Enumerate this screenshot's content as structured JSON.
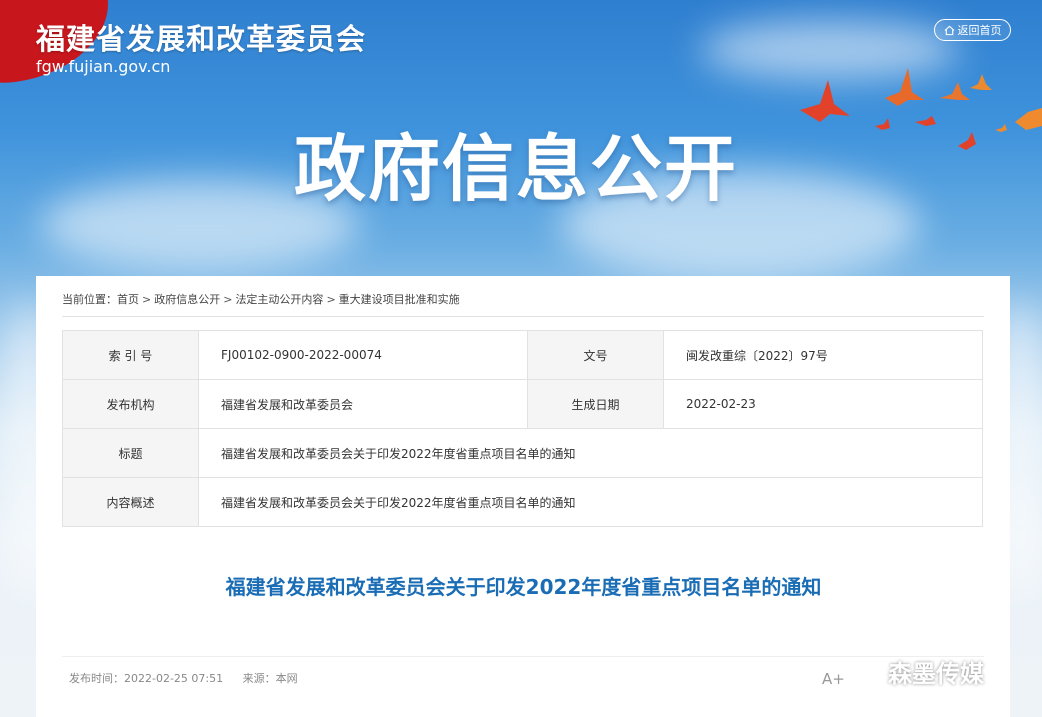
{
  "header": {
    "site_title": "福建省发展和改革委员会",
    "site_domain": "fgw.fujian.gov.cn",
    "back_home": "返回首页",
    "banner_heading": "政府信息公开"
  },
  "breadcrumb": {
    "prefix": "当前位置：",
    "items": [
      "首页",
      "政府信息公开",
      "法定主动公开内容",
      "重大建设项目批准和实施"
    ],
    "separator": ">"
  },
  "meta": {
    "index_label": "索 引 号",
    "index_value": "FJ00102-0900-2022-00074",
    "docno_label": "文号",
    "docno_value": "闽发改重综〔2022〕97号",
    "publisher_label": "发布机构",
    "publisher_value": "福建省发展和改革委员会",
    "date_label": "生成日期",
    "date_value": "2022-02-23",
    "title_label": "标题",
    "title_value": "福建省发展和改革委员会关于印发2022年度省重点项目名单的通知",
    "summary_label": "内容概述",
    "summary_value": "福建省发展和改革委员会关于印发2022年度省重点项目名单的通知"
  },
  "article": {
    "title": "福建省发展和改革委员会关于印发2022年度省重点项目名单的通知",
    "publish_time": "发布时间：2022-02-25 07:51",
    "source": "来源：本网",
    "font_size_button": "A+"
  },
  "watermark": {
    "text": "森墨传媒",
    "icon": "wechat-icon"
  },
  "colors": {
    "title_blue": "#1a6db5",
    "ribbon_red": "#c8161d"
  }
}
